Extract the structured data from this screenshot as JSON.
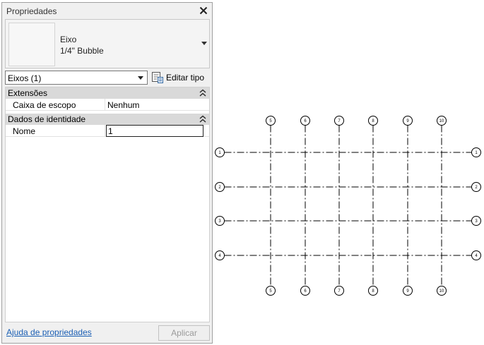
{
  "panel": {
    "title": "Propriedades",
    "type_selector": {
      "family": "Eixo",
      "type_name": "1/4\" Bubble"
    },
    "instance_filter": "Eixos (1)",
    "edit_type_label": "Editar tipo",
    "groups": [
      {
        "label": "Extensões",
        "rows": [
          {
            "name": "Caixa de escopo",
            "value": "Nenhum"
          }
        ]
      },
      {
        "label": "Dados de identidade",
        "rows": [
          {
            "name": "Nome",
            "value": "1"
          }
        ]
      }
    ],
    "help_link": "Ajuda de propriedades",
    "apply_label": "Aplicar"
  },
  "drawing": {
    "vertical_grids": [
      "5",
      "6",
      "7",
      "8",
      "9",
      "10"
    ],
    "horizontal_grids": [
      "1",
      "2",
      "3",
      "4"
    ],
    "line_color": "#000000"
  }
}
